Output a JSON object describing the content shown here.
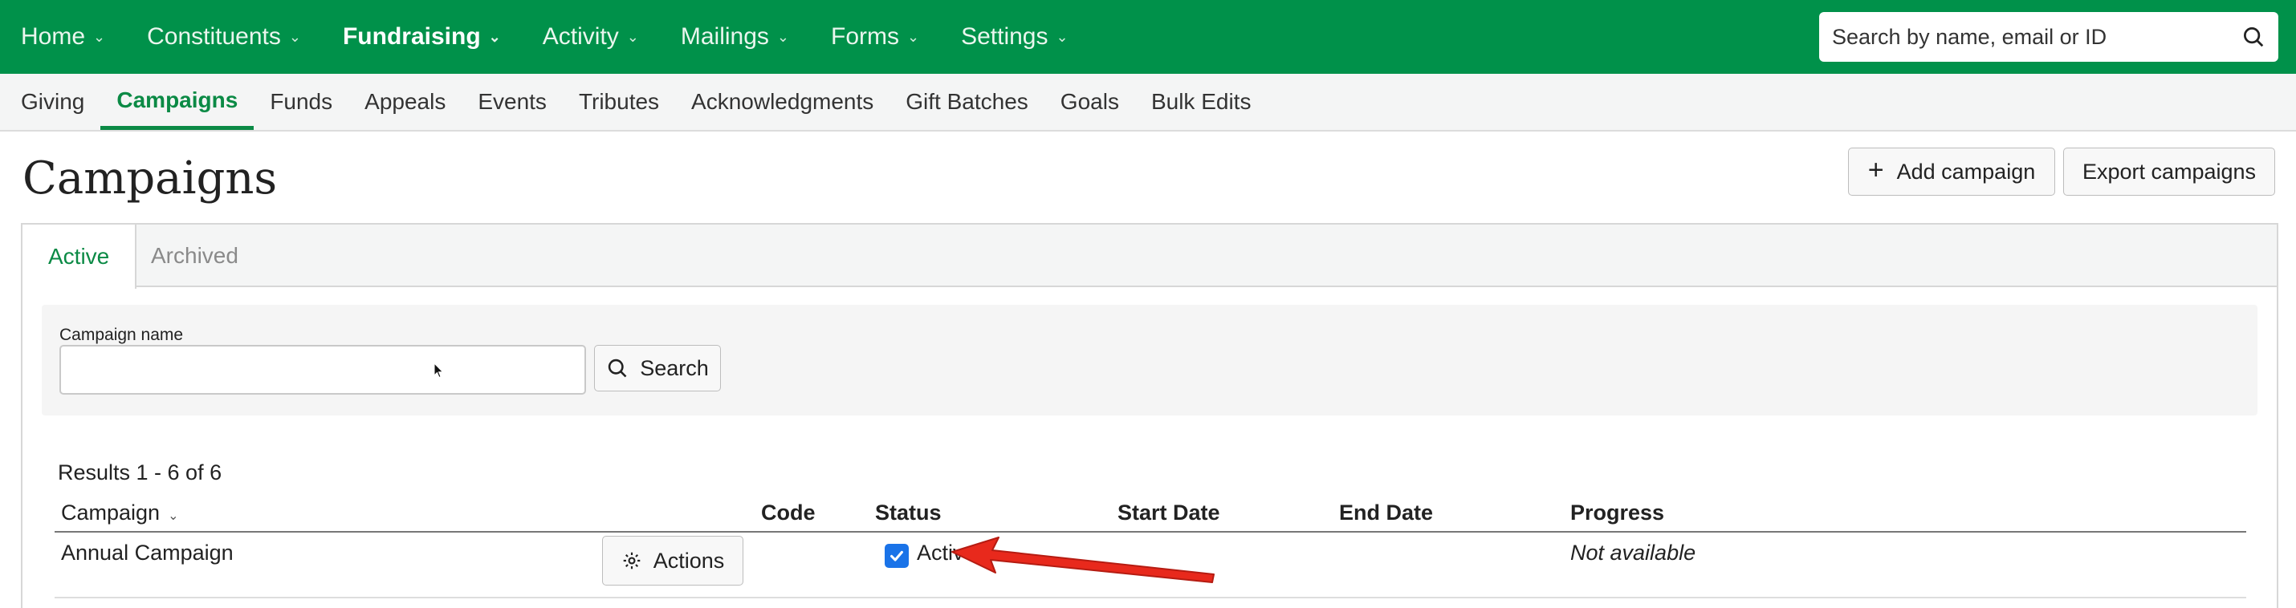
{
  "topnav": {
    "items": [
      {
        "label": "Home",
        "active": false
      },
      {
        "label": "Constituents",
        "active": false
      },
      {
        "label": "Fundraising",
        "active": true
      },
      {
        "label": "Activity",
        "active": false
      },
      {
        "label": "Mailings",
        "active": false
      },
      {
        "label": "Forms",
        "active": false
      },
      {
        "label": "Settings",
        "active": false
      }
    ],
    "search_placeholder": "Search by name, email or ID",
    "brand_color": "#00914a"
  },
  "subnav": {
    "items": [
      {
        "label": "Giving"
      },
      {
        "label": "Campaigns",
        "active": true
      },
      {
        "label": "Funds"
      },
      {
        "label": "Appeals"
      },
      {
        "label": "Events"
      },
      {
        "label": "Tributes"
      },
      {
        "label": "Acknowledgments"
      },
      {
        "label": "Gift Batches"
      },
      {
        "label": "Goals"
      },
      {
        "label": "Bulk Edits"
      }
    ]
  },
  "page": {
    "title": "Campaigns",
    "add_button": "Add campaign",
    "export_button": "Export campaigns"
  },
  "tabs": {
    "active": "Active",
    "archived": "Archived"
  },
  "filter": {
    "field_label": "Campaign name",
    "field_value": "",
    "search_button": "Search"
  },
  "results": {
    "summary": "Results 1 - 6 of 6",
    "columns": [
      "Campaign",
      "Code",
      "Status",
      "Start Date",
      "End Date",
      "Progress"
    ],
    "rows": [
      {
        "campaign": "Annual Campaign",
        "actions_label": "Actions",
        "code": "",
        "status_checked": true,
        "status": "Active",
        "start_date": "",
        "end_date": "",
        "progress": "Not available"
      }
    ]
  }
}
